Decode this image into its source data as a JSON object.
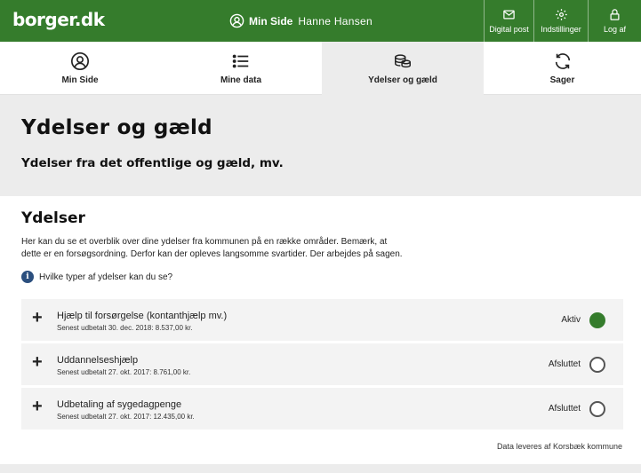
{
  "header": {
    "logo": "borger.dk",
    "min_side_label": "Min Side",
    "user_name": "Hanne Hansen",
    "buttons": {
      "digital_post": "Digital post",
      "indstillinger": "Indstillinger",
      "log_af": "Log af"
    },
    "brand_color": "#357c2c"
  },
  "nav": {
    "tabs": [
      {
        "label": "Min Side",
        "icon": "user-circle-icon"
      },
      {
        "label": "Mine data",
        "icon": "list-icon"
      },
      {
        "label": "Ydelser og gæld",
        "icon": "coins-icon",
        "active": true
      },
      {
        "label": "Sager",
        "icon": "refresh-icon"
      }
    ]
  },
  "hero": {
    "title": "Ydelser og gæld",
    "subtitle": "Ydelser fra det offentlige og gæld, mv."
  },
  "section": {
    "title": "Ydelser",
    "description_line1": "Her kan du se et overblik over dine ydelser fra kommunen på en række områder. Bemærk, at",
    "description_line2": "dette er en forsøgsordning. Derfor kan der opleves langsomme svartider. Der arbejdes på sagen.",
    "info_link": "Hvilke typer af ydelser kan du se?"
  },
  "benefits": [
    {
      "title": "Hjælp til forsørgelse (kontanthjælp mv.)",
      "subtitle": "Senest udbetalt 30. dec. 2018: 8.537,00 kr.",
      "status": "Aktiv",
      "state": "active"
    },
    {
      "title": "Uddannelseshjælp",
      "subtitle": "Senest udbetalt 27. okt. 2017: 8.761,00 kr.",
      "status": "Afsluttet",
      "state": "closed"
    },
    {
      "title": "Udbetaling af sygedagpenge",
      "subtitle": "Senest udbetalt 27. okt. 2017: 12.435,00 kr.",
      "status": "Afsluttet",
      "state": "closed"
    }
  ],
  "footer": {
    "note": "Data leveres af Korsbæk kommune"
  }
}
